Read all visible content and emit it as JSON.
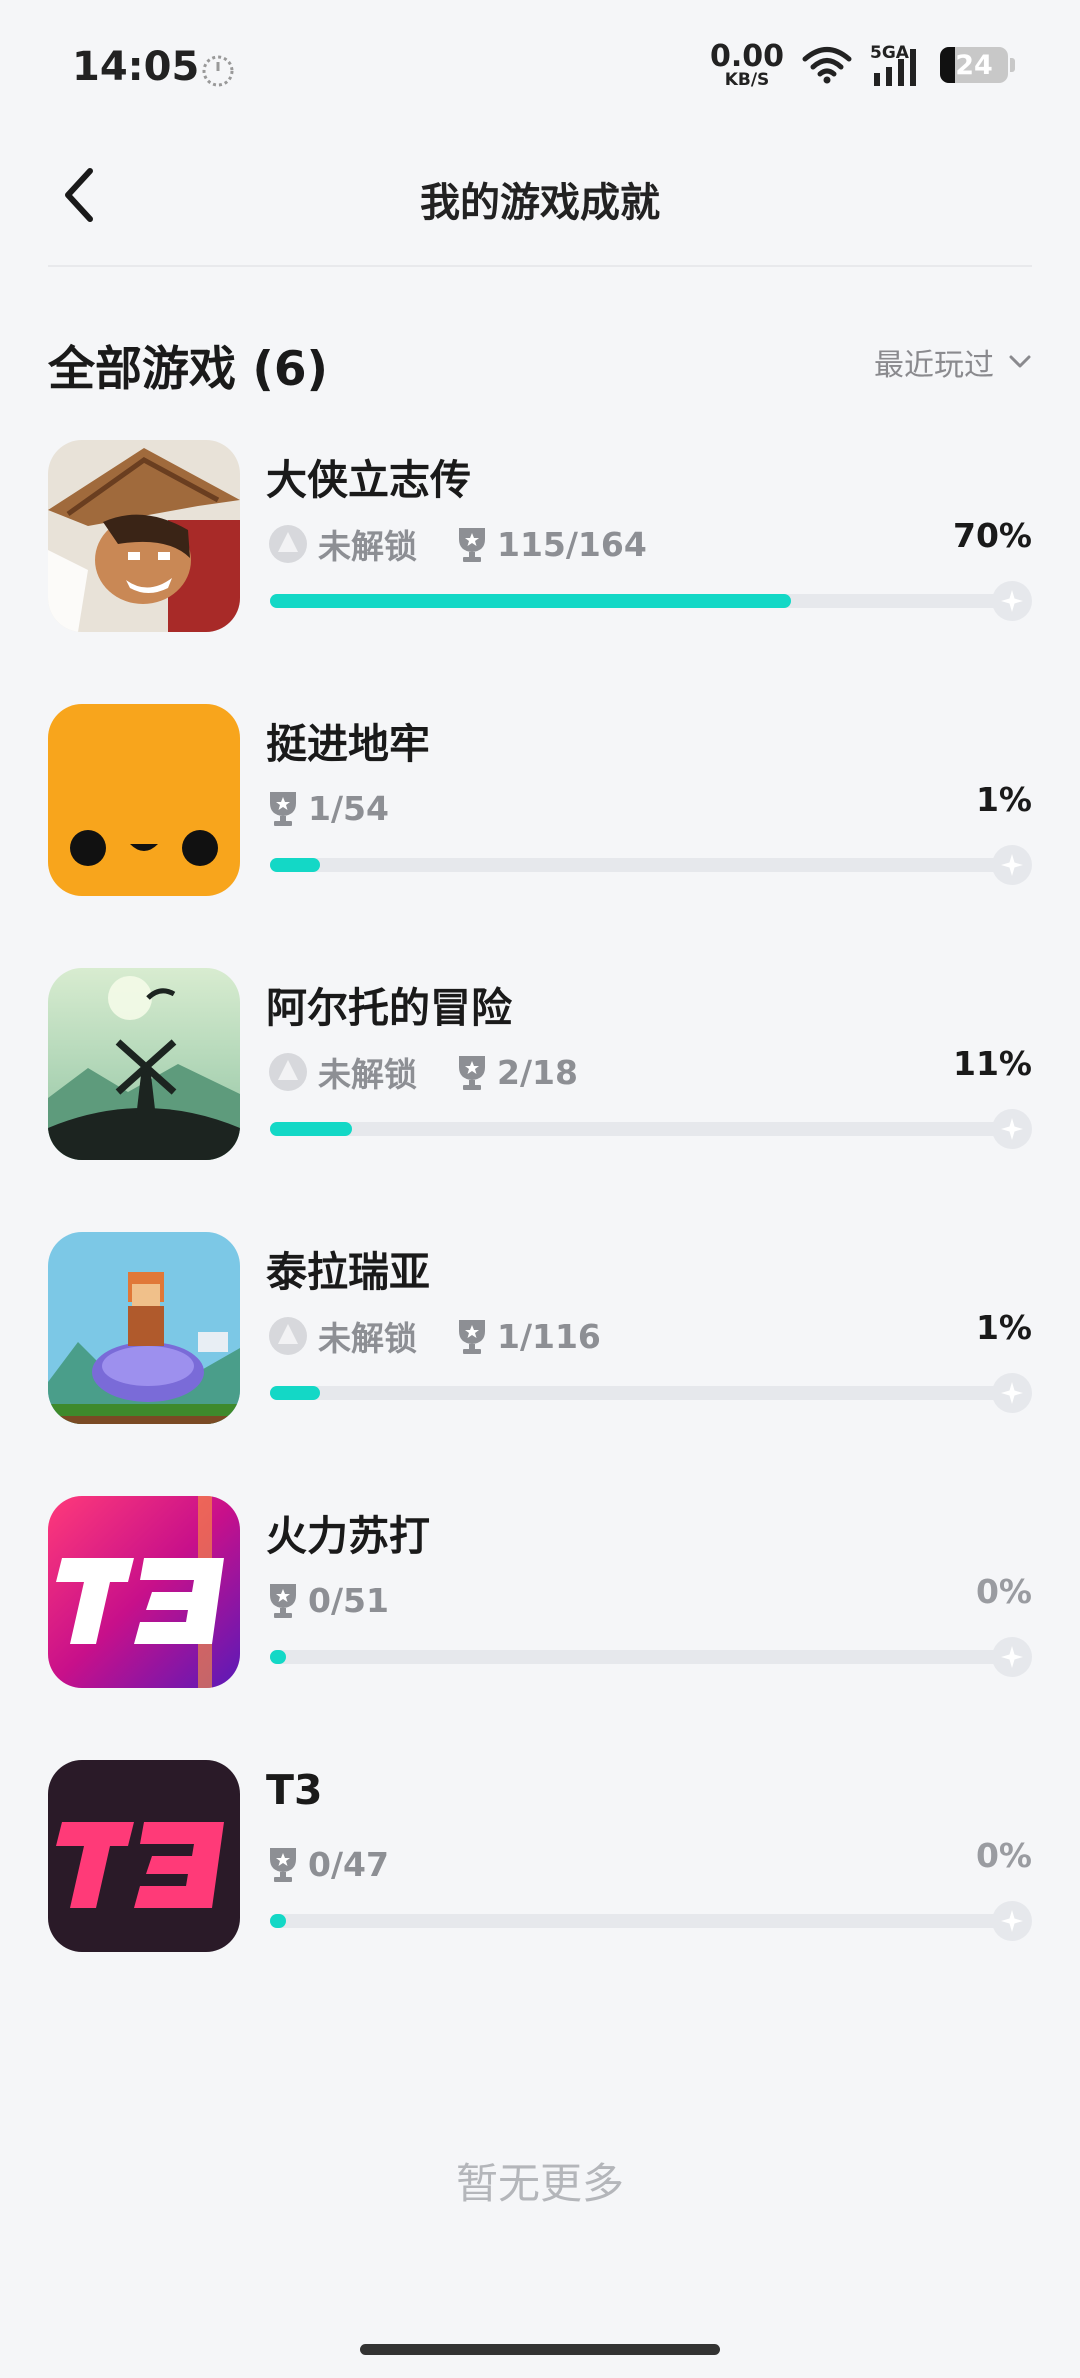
{
  "status_bar": {
    "time": "14:05",
    "net_speed_value": "0.00",
    "net_speed_unit": "KB/S",
    "network_type": "5GA",
    "battery": "24"
  },
  "nav": {
    "title": "我的游戏成就",
    "back_icon": "chevron-left-icon"
  },
  "section": {
    "title": "全部游戏 (6)",
    "sort_label": "最近玩过"
  },
  "colors": {
    "accent": "#13d8c6",
    "track": "#e6e8ec",
    "background": "#f5f6f8"
  },
  "games": [
    {
      "name": "大侠立志传",
      "locked_label": "未解锁",
      "trophies": "115/164",
      "percent_label": "70%",
      "progress": 0.7
    },
    {
      "name": "挺进地牢",
      "locked_label": "",
      "trophies": "1/54",
      "percent_label": "1%",
      "progress": 0.01
    },
    {
      "name": "阿尔托的冒险",
      "locked_label": "未解锁",
      "trophies": "2/18",
      "percent_label": "11%",
      "progress": 0.11
    },
    {
      "name": "泰拉瑞亚",
      "locked_label": "未解锁",
      "trophies": "1/116",
      "percent_label": "1%",
      "progress": 0.01
    },
    {
      "name": "火力苏打",
      "locked_label": "",
      "trophies": "0/51",
      "percent_label": "0%",
      "progress": 0.0
    },
    {
      "name": "T3",
      "locked_label": "",
      "trophies": "0/47",
      "percent_label": "0%",
      "progress": 0.0
    }
  ],
  "footer": {
    "no_more": "暂无更多"
  }
}
